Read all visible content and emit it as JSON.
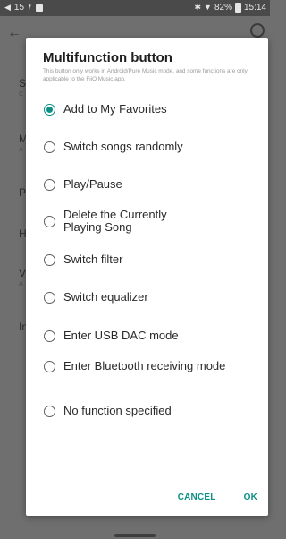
{
  "status_bar": {
    "left_text": "15",
    "battery_percent": "82%",
    "time": "15:14"
  },
  "background": {
    "row_letters": [
      "S",
      "M",
      "P",
      "H",
      "V",
      "In"
    ],
    "row_subs": [
      "C",
      "A",
      "",
      "",
      "A",
      ""
    ]
  },
  "dialog": {
    "title": "Multifunction button",
    "description": "This button only works in Android/Pure Music mode, and some functions are only applicable to the FiiO Music app.",
    "options": [
      {
        "label": "Add to My Favorites",
        "selected": true
      },
      {
        "label": "Switch songs randomly",
        "selected": false
      },
      {
        "label": "Play/Pause",
        "selected": false
      },
      {
        "label": "Delete the Currently Playing Song",
        "selected": false
      },
      {
        "label": "Switch filter",
        "selected": false
      },
      {
        "label": "Switch equalizer",
        "selected": false
      },
      {
        "label": "Enter USB DAC mode",
        "selected": false
      },
      {
        "label": "Enter Bluetooth receiving mode",
        "selected": false
      },
      {
        "label": "No function specified",
        "selected": false
      }
    ],
    "cancel_label": "CANCEL",
    "ok_label": "OK"
  },
  "colors": {
    "accent": "#0a8f84",
    "scrim": "#6f6f6f"
  }
}
